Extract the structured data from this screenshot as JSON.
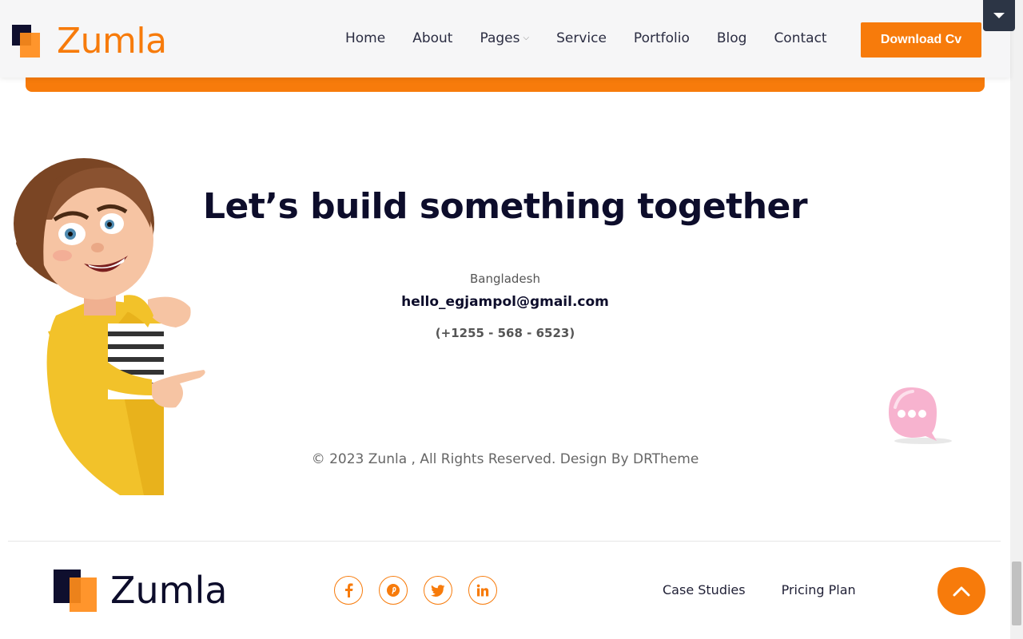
{
  "header": {
    "logo_text": "Zumla",
    "nav": [
      {
        "label": "Home"
      },
      {
        "label": "About"
      },
      {
        "label": "Pages",
        "has_dropdown": true
      },
      {
        "label": "Service"
      },
      {
        "label": "Portfolio"
      },
      {
        "label": "Blog"
      },
      {
        "label": "Contact"
      }
    ],
    "cta_label": "Download Cv"
  },
  "contact": {
    "headline": "Let’s build something together",
    "country": "Bangladesh",
    "email": "hello_egjampol@gmail.com",
    "phone": "(+1255 - 568 - 6523)"
  },
  "copyright": "© 2023 Zunla , All Rights Reserved. Design By DRTheme",
  "footer": {
    "logo_text": "Zumla",
    "social": [
      {
        "name": "facebook-icon"
      },
      {
        "name": "pinterest-icon"
      },
      {
        "name": "twitter-icon"
      },
      {
        "name": "linkedin-icon"
      }
    ],
    "links": [
      "Case Studies",
      "Pricing Plan"
    ]
  },
  "colors": {
    "accent": "#f77b0b",
    "dark": "#0d0d2b",
    "toggle_bg": "#2c3545"
  }
}
